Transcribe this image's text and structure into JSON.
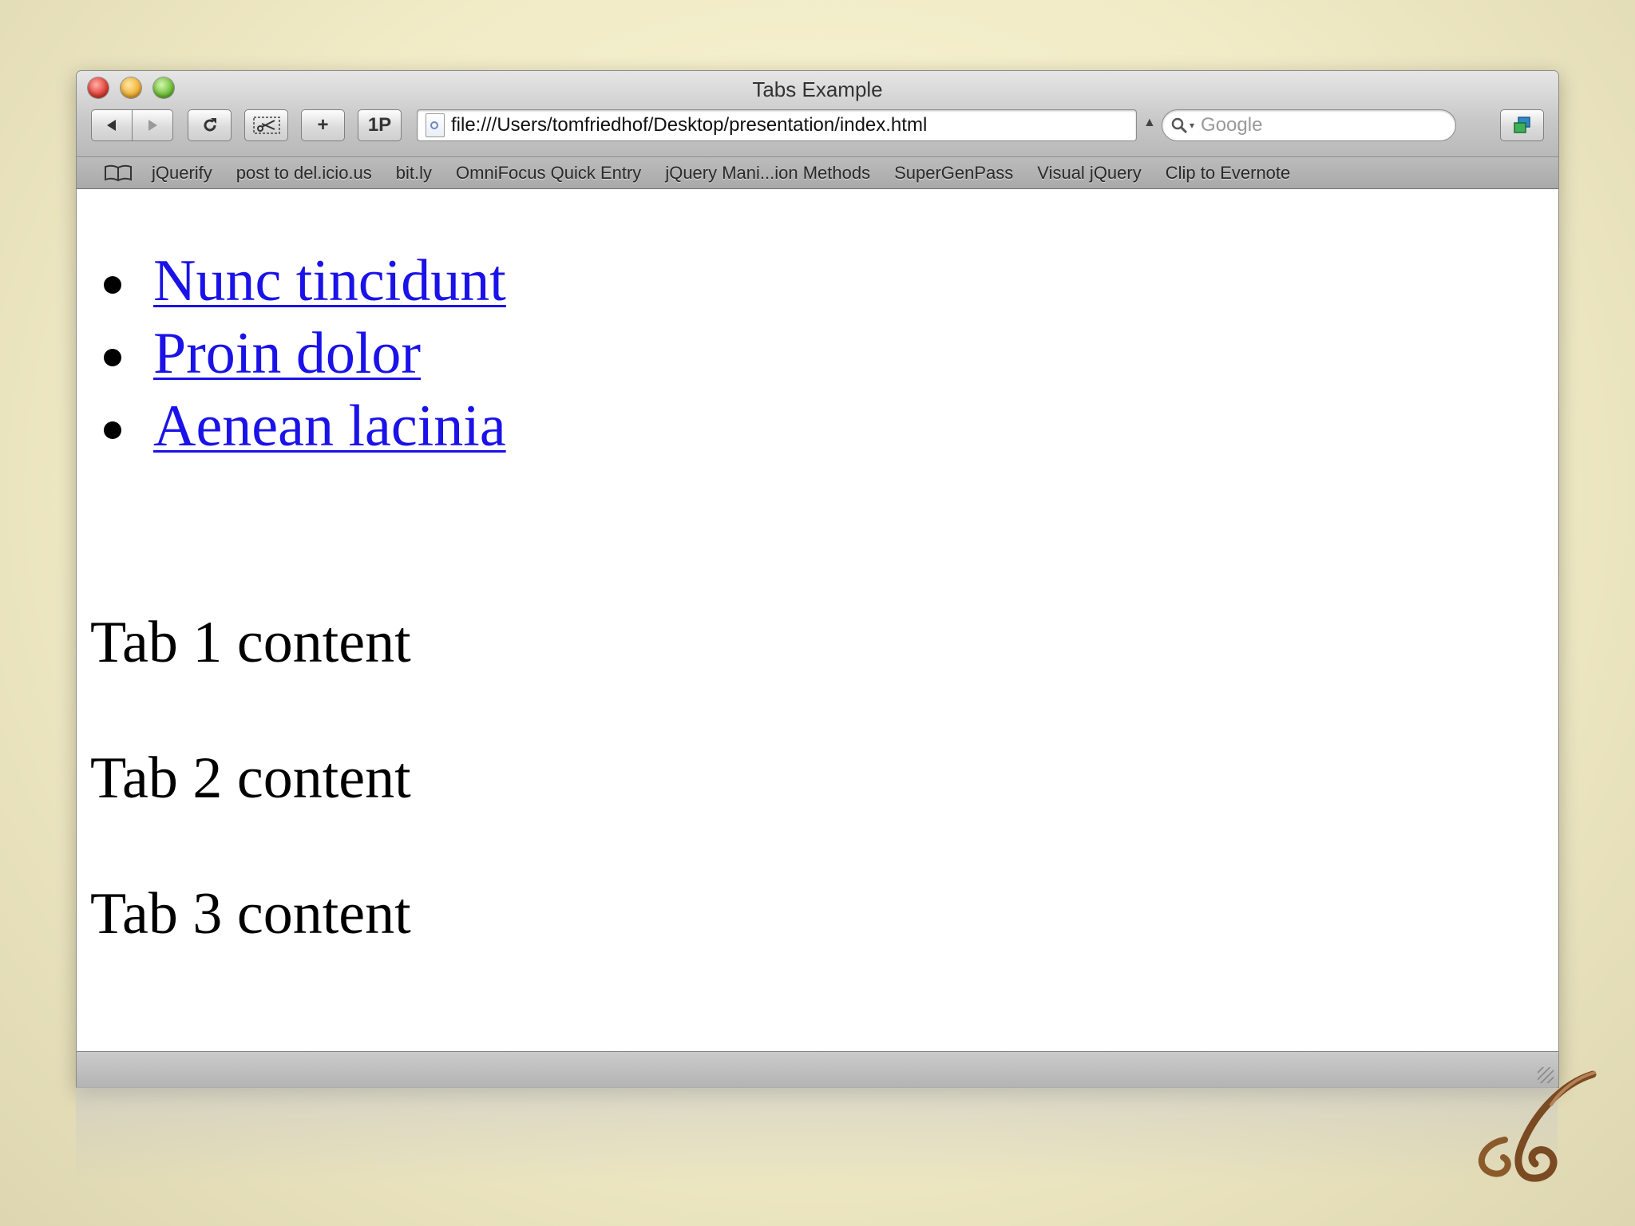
{
  "window": {
    "title": "Tabs Example"
  },
  "toolbar": {
    "onepassword_label": "1P",
    "add_bookmark_label": "+",
    "url": "file:///Users/tomfriedhof/Desktop/presentation/index.html",
    "search_placeholder": "Google"
  },
  "bookmarks": {
    "items": [
      {
        "label": "jQuerify"
      },
      {
        "label": "post to del.icio.us"
      },
      {
        "label": "bit.ly"
      },
      {
        "label": "OmniFocus Quick Entry"
      },
      {
        "label": "jQuery Mani...ion Methods"
      },
      {
        "label": "SuperGenPass"
      },
      {
        "label": "Visual jQuery"
      },
      {
        "label": "Clip to Evernote"
      }
    ]
  },
  "page": {
    "tabs": [
      {
        "label": "Nunc tincidunt"
      },
      {
        "label": "Proin dolor"
      },
      {
        "label": "Aenean lacinia"
      }
    ],
    "panels": [
      {
        "text": "Tab 1 content"
      },
      {
        "text": "Tab 2 content"
      },
      {
        "text": "Tab 3 content"
      }
    ]
  },
  "colors": {
    "link": "#1a12e8",
    "background": "#f1ebc6"
  }
}
